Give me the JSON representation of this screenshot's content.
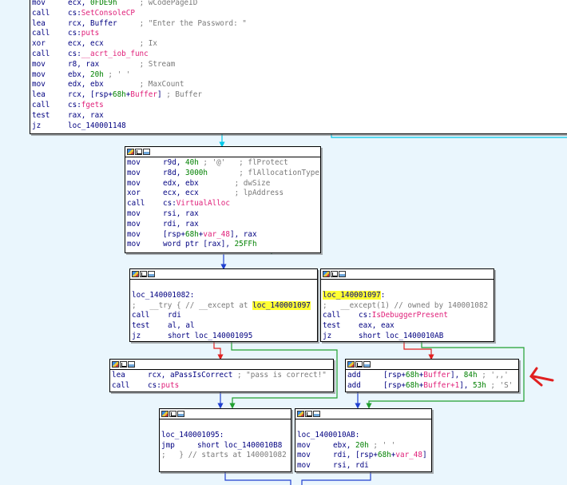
{
  "colors": {
    "background": "#eaf6fd",
    "edge_normal": "#2040d0",
    "edge_true": "#20a030",
    "edge_false": "#e02020",
    "edge_cyan": "#00c8e8",
    "highlight": "#ffff33",
    "annotation_green": "#1a7a4a",
    "annotation_red": "#e02020"
  },
  "nodes": {
    "top": {
      "lines": [
        [
          {
            "t": "mov",
            "c": "mn"
          },
          {
            "t": "ecx, ",
            "c": "op"
          },
          {
            "t": "0FDE9h",
            "c": "num"
          },
          {
            "t": "     ; wCodePageID",
            "c": "cm"
          }
        ],
        [
          {
            "t": "call",
            "c": "mn"
          },
          {
            "t": "cs:",
            "c": "op"
          },
          {
            "t": "SetConsoleCP",
            "c": "api"
          }
        ],
        [
          {
            "t": "lea",
            "c": "mn"
          },
          {
            "t": "rcx, Buffer     ",
            "c": "op"
          },
          {
            "t": "; \"Enter the Password: \"",
            "c": "cm"
          }
        ],
        [
          {
            "t": "call",
            "c": "mn"
          },
          {
            "t": "cs:",
            "c": "op"
          },
          {
            "t": "puts",
            "c": "api"
          }
        ],
        [
          {
            "t": "xor",
            "c": "mn"
          },
          {
            "t": "ecx, ecx        ",
            "c": "op"
          },
          {
            "t": "; Ix",
            "c": "cm"
          }
        ],
        [
          {
            "t": "call",
            "c": "mn"
          },
          {
            "t": "cs:",
            "c": "op"
          },
          {
            "t": "__acrt_iob_func",
            "c": "api"
          }
        ],
        [
          {
            "t": "mov",
            "c": "mn"
          },
          {
            "t": "r8, rax         ",
            "c": "op"
          },
          {
            "t": "; Stream",
            "c": "cm"
          }
        ],
        [
          {
            "t": "mov",
            "c": "mn"
          },
          {
            "t": "ebx, ",
            "c": "op"
          },
          {
            "t": "20h",
            "c": "num"
          },
          {
            "t": " ; ' '",
            "c": "cm"
          }
        ],
        [
          {
            "t": "mov",
            "c": "mn"
          },
          {
            "t": "edx, ebx        ",
            "c": "op"
          },
          {
            "t": "; MaxCount",
            "c": "cm"
          }
        ],
        [
          {
            "t": "lea",
            "c": "mn"
          },
          {
            "t": "rcx, [rsp+",
            "c": "op"
          },
          {
            "t": "68h",
            "c": "num"
          },
          {
            "t": "+",
            "c": "op"
          },
          {
            "t": "Buffer",
            "c": "api"
          },
          {
            "t": "] ",
            "c": "op"
          },
          {
            "t": "; Buffer",
            "c": "cm"
          }
        ],
        [
          {
            "t": "call",
            "c": "mn"
          },
          {
            "t": "cs:",
            "c": "op"
          },
          {
            "t": "fgets",
            "c": "api"
          }
        ],
        [
          {
            "t": "test",
            "c": "mn"
          },
          {
            "t": "rax, rax",
            "c": "op"
          }
        ],
        [
          {
            "t": "jz",
            "c": "mn"
          },
          {
            "t": "loc_140001148",
            "c": "op"
          }
        ]
      ]
    },
    "alloc": {
      "lines": [
        [
          {
            "t": "mov",
            "c": "mn"
          },
          {
            "t": "r9d, ",
            "c": "op"
          },
          {
            "t": "40h",
            "c": "num"
          },
          {
            "t": " ; '@'   ",
            "c": "cm"
          },
          {
            "t": "; flProtect",
            "c": "cm"
          }
        ],
        [
          {
            "t": "mov",
            "c": "mn"
          },
          {
            "t": "r8d, ",
            "c": "op"
          },
          {
            "t": "3000h",
            "c": "num"
          },
          {
            "t": "       ",
            "c": "op"
          },
          {
            "t": "; flAllocationType",
            "c": "cm"
          }
        ],
        [
          {
            "t": "mov",
            "c": "mn"
          },
          {
            "t": "edx, ebx        ",
            "c": "op"
          },
          {
            "t": "; dwSize",
            "c": "cm"
          }
        ],
        [
          {
            "t": "xor",
            "c": "mn"
          },
          {
            "t": "ecx, ecx        ",
            "c": "op"
          },
          {
            "t": "; lpAddress",
            "c": "cm"
          }
        ],
        [
          {
            "t": "call",
            "c": "mn"
          },
          {
            "t": "cs:",
            "c": "op"
          },
          {
            "t": "VirtualAlloc",
            "c": "api"
          }
        ],
        [
          {
            "t": "mov",
            "c": "mn"
          },
          {
            "t": "rsi, rax",
            "c": "op"
          }
        ],
        [
          {
            "t": "mov",
            "c": "mn"
          },
          {
            "t": "rdi, rax",
            "c": "op"
          }
        ],
        [
          {
            "t": "mov",
            "c": "mn"
          },
          {
            "t": "[rsp+",
            "c": "op"
          },
          {
            "t": "68h",
            "c": "num"
          },
          {
            "t": "+",
            "c": "op"
          },
          {
            "t": "var_48",
            "c": "api"
          },
          {
            "t": "], rax",
            "c": "op"
          }
        ],
        [
          {
            "t": "mov",
            "c": "mn"
          },
          {
            "t": "word ptr [rax], ",
            "c": "op"
          },
          {
            "t": "25FFh",
            "c": "num"
          }
        ]
      ]
    },
    "try": {
      "lines": [
        [],
        [
          {
            "t": "loc_140001082:",
            "c": "lbl"
          }
        ],
        [
          {
            "t": ";   __try { // __except at ",
            "c": "cm"
          },
          {
            "t": "loc_140001097",
            "c": "hl"
          }
        ],
        [
          {
            "t": "call",
            "c": "mn"
          },
          {
            "t": "rdi",
            "c": "op"
          }
        ],
        [
          {
            "t": "test",
            "c": "mn"
          },
          {
            "t": "al, al",
            "c": "op"
          }
        ],
        [
          {
            "t": "jz",
            "c": "mn"
          },
          {
            "t": "short loc_140001095",
            "c": "op"
          }
        ]
      ]
    },
    "except": {
      "lines": [
        [],
        [
          {
            "t": "loc_140001097",
            "c": "hl"
          },
          {
            "t": ":",
            "c": "lbl"
          }
        ],
        [
          {
            "t": ";   __except(1) // owned by 140001082",
            "c": "cm"
          }
        ],
        [
          {
            "t": "call",
            "c": "mn"
          },
          {
            "t": "cs:",
            "c": "op"
          },
          {
            "t": "IsDebuggerPresent",
            "c": "api"
          }
        ],
        [
          {
            "t": "test",
            "c": "mn"
          },
          {
            "t": "eax, eax",
            "c": "op"
          }
        ],
        [
          {
            "t": "jz",
            "c": "mn"
          },
          {
            "t": "short loc_1400010AB",
            "c": "op"
          }
        ]
      ]
    },
    "pass": {
      "lines": [
        [
          {
            "t": "lea",
            "c": "mn"
          },
          {
            "t": "rcx, aPassIsCorrect ",
            "c": "op"
          },
          {
            "t": "; \"pass is correct!\"",
            "c": "cm"
          }
        ],
        [
          {
            "t": "call",
            "c": "mn"
          },
          {
            "t": "cs:",
            "c": "op"
          },
          {
            "t": "puts",
            "c": "api"
          }
        ]
      ]
    },
    "add": {
      "lines": [
        [
          {
            "t": "add",
            "c": "mn"
          },
          {
            "t": "[rsp+",
            "c": "op"
          },
          {
            "t": "68h",
            "c": "num"
          },
          {
            "t": "+",
            "c": "op"
          },
          {
            "t": "Buffer",
            "c": "api"
          },
          {
            "t": "], ",
            "c": "op"
          },
          {
            "t": "84h",
            "c": "num"
          },
          {
            "t": " ; ',,'",
            "c": "cm"
          }
        ],
        [
          {
            "t": "add",
            "c": "mn"
          },
          {
            "t": "[rsp+",
            "c": "op"
          },
          {
            "t": "68h",
            "c": "num"
          },
          {
            "t": "+",
            "c": "op"
          },
          {
            "t": "Buffer+1",
            "c": "api"
          },
          {
            "t": "], ",
            "c": "op"
          },
          {
            "t": "53h",
            "c": "num"
          },
          {
            "t": " ; 'S'",
            "c": "cm"
          }
        ]
      ]
    },
    "l1095": {
      "lines": [
        [],
        [
          {
            "t": "loc_140001095:",
            "c": "lbl"
          }
        ],
        [
          {
            "t": "jmp",
            "c": "mn"
          },
          {
            "t": "short loc_1400010B8",
            "c": "op"
          }
        ],
        [
          {
            "t": ";   } // starts at 140001082",
            "c": "cm"
          }
        ]
      ]
    },
    "l10ab": {
      "lines": [
        [],
        [
          {
            "t": "loc_1400010AB:",
            "c": "lbl"
          }
        ],
        [
          {
            "t": "mov",
            "c": "mn"
          },
          {
            "t": "ebx, ",
            "c": "op"
          },
          {
            "t": "20h",
            "c": "num"
          },
          {
            "t": " ; ' '",
            "c": "cm"
          }
        ],
        [
          {
            "t": "mov",
            "c": "mn"
          },
          {
            "t": "rdi, [rsp+",
            "c": "op"
          },
          {
            "t": "68h",
            "c": "num"
          },
          {
            "t": "+",
            "c": "op"
          },
          {
            "t": "var_48",
            "c": "api"
          },
          {
            "t": "]",
            "c": "op"
          }
        ],
        [
          {
            "t": "mov",
            "c": "mn"
          },
          {
            "t": "rsi, rdi",
            "c": "op"
          }
        ]
      ]
    }
  }
}
